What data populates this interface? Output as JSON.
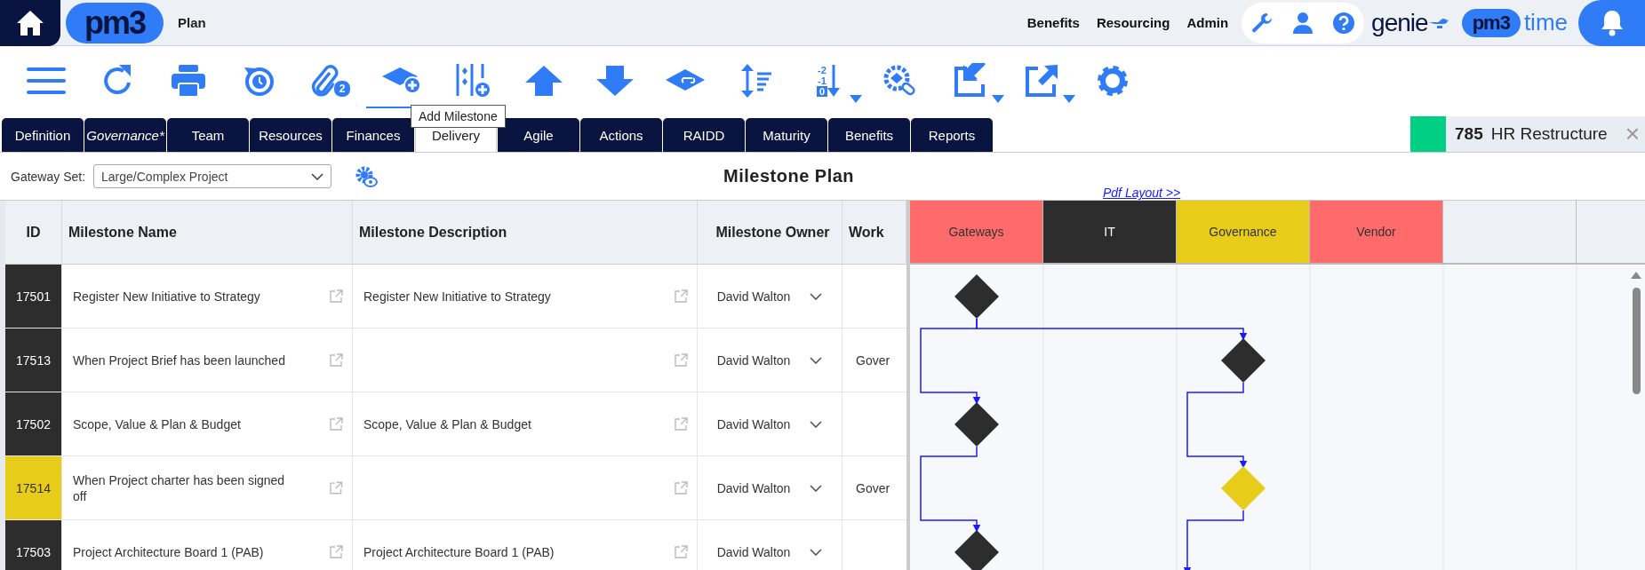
{
  "top_bar": {
    "logo": "pm3",
    "page_title": "Plan",
    "nav_links": [
      {
        "label": "Benefits"
      },
      {
        "label": "Resourcing"
      },
      {
        "label": "Admin"
      }
    ],
    "genie_logo": "genie",
    "time_logo": {
      "mark": "pm3",
      "label": "time"
    }
  },
  "toolbar": {
    "tools": [
      {
        "kind": "menu",
        "selected": false,
        "dropdown": false
      },
      {
        "kind": "refresh",
        "selected": false,
        "dropdown": false
      },
      {
        "kind": "print",
        "selected": false,
        "dropdown": false
      },
      {
        "kind": "history",
        "selected": false,
        "dropdown": false
      },
      {
        "kind": "attachments",
        "selected": false,
        "dropdown": false,
        "badge": "2"
      },
      {
        "kind": "add-milestone",
        "selected": true,
        "dropdown": false,
        "tooltip": "Add Milestone"
      },
      {
        "kind": "add-column",
        "selected": false,
        "dropdown": false
      },
      {
        "kind": "move-up",
        "selected": false,
        "dropdown": false
      },
      {
        "kind": "move-down",
        "selected": false,
        "dropdown": false
      },
      {
        "kind": "link-milestone",
        "selected": false,
        "dropdown": false
      },
      {
        "kind": "sort",
        "selected": false,
        "dropdown": false
      },
      {
        "kind": "renumber",
        "selected": false,
        "dropdown": true,
        "labels": [
          "-2",
          "-1",
          "0"
        ]
      },
      {
        "kind": "linked-settings",
        "selected": false,
        "dropdown": false
      },
      {
        "kind": "import",
        "selected": false,
        "dropdown": true
      },
      {
        "kind": "export",
        "selected": false,
        "dropdown": true
      },
      {
        "kind": "settings",
        "selected": false,
        "dropdown": false
      }
    ]
  },
  "tabs": [
    {
      "label": "Definition",
      "selected": false,
      "unsaved": false
    },
    {
      "label": "Governance*",
      "selected": false,
      "unsaved": true
    },
    {
      "label": "Team",
      "selected": false,
      "unsaved": false
    },
    {
      "label": "Resources",
      "selected": false,
      "unsaved": false
    },
    {
      "label": "Finances",
      "selected": false,
      "unsaved": false
    },
    {
      "label": "Delivery",
      "selected": true,
      "unsaved": false
    },
    {
      "label": "Agile",
      "selected": false,
      "unsaved": false
    },
    {
      "label": "Actions",
      "selected": false,
      "unsaved": false
    },
    {
      "label": "RAIDD",
      "selected": false,
      "unsaved": false
    },
    {
      "label": "Maturity",
      "selected": false,
      "unsaved": false
    },
    {
      "label": "Benefits",
      "selected": false,
      "unsaved": false
    },
    {
      "label": "Reports",
      "selected": false,
      "unsaved": false
    }
  ],
  "project": {
    "number": "785",
    "name": "HR Restructure",
    "close": "×"
  },
  "gateway_set": {
    "label": "Gateway Set:",
    "value": "Large/Complex Project"
  },
  "title": "Milestone Plan",
  "pdf_link": "Pdf Layout >>",
  "table": {
    "columns": [
      "ID",
      "Milestone Name",
      "Milestone Description",
      "Milestone Owner",
      "Work"
    ],
    "rows": [
      {
        "id": "17501",
        "color": "#2d2d2d",
        "kind": "gateway",
        "name": "Register New Initiative to Strategy",
        "description": "Register New Initiative to Strategy",
        "owner": "David Walton"
      },
      {
        "id": "17513",
        "color": "#2d2d2d",
        "kind": "workstream",
        "name": "When Project Brief has been launched",
        "owner": "David Walton",
        "work": "Gover"
      },
      {
        "id": "17502",
        "color": "#2d2d2d",
        "kind": "gateway",
        "name": "Scope, Value & Plan & Budget",
        "description": "Scope, Value & Plan & Budget",
        "owner": "David Walton"
      },
      {
        "id": "17514",
        "color": "#e8cc1a",
        "kind": "workstream",
        "name": "When Project charter has been signed off",
        "owner": "David Walton",
        "work": "Gover"
      },
      {
        "id": "17503",
        "color": "#2d2d2d",
        "kind": "gateway",
        "name": "Project Architecture Board 1 (PAB)",
        "description": "Project Architecture Board 1 (PAB)",
        "owner": "David Walton"
      }
    ]
  },
  "gantt": {
    "lanes": [
      {
        "label": "Gateways",
        "color": "#ff6b6b"
      },
      {
        "label": "IT",
        "color": "#2d2d2d"
      },
      {
        "label": "Governance",
        "color": "#e8cc1a"
      },
      {
        "label": "Vendor",
        "color": "#ff6b6b"
      }
    ]
  }
}
